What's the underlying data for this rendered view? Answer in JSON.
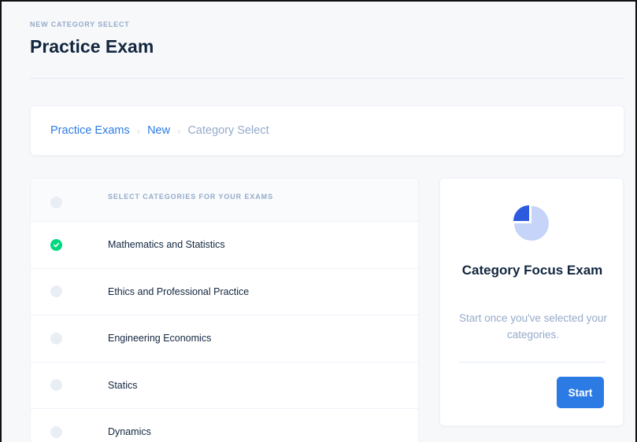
{
  "header": {
    "pretitle": "NEW CATEGORY SELECT",
    "title": "Practice Exam"
  },
  "breadcrumb": {
    "items": [
      {
        "label": "Practice Exams",
        "link": true
      },
      {
        "label": "New",
        "link": true
      },
      {
        "label": "Category Select",
        "link": false
      }
    ],
    "separator": "›"
  },
  "categories": {
    "header_label": "SELECT CATEGORIES FOR YOUR EXAMS",
    "items": [
      {
        "label": "Mathematics and Statistics",
        "checked": true
      },
      {
        "label": "Ethics and Professional Practice",
        "checked": false
      },
      {
        "label": "Engineering Economics",
        "checked": false
      },
      {
        "label": "Statics",
        "checked": false
      },
      {
        "label": "Dynamics",
        "checked": false
      }
    ]
  },
  "focus_card": {
    "icon": "pie-chart-icon",
    "title": "Category Focus Exam",
    "subtitle": "Start once you've selected your categories.",
    "start_label": "Start"
  },
  "colors": {
    "accent": "#2c7be5",
    "success": "#00d97e",
    "muted": "#95aac9",
    "pie_light": "#c5d4f8",
    "pie_dark": "#2c5be0"
  }
}
